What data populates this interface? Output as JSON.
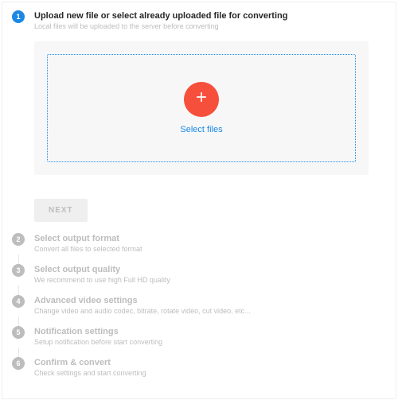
{
  "steps": [
    {
      "num": "1",
      "title": "Upload new file or select already uploaded file for converting",
      "sub": "Local files will be uploaded to the server before converting"
    },
    {
      "num": "2",
      "title": "Select output format",
      "sub": "Convert all files to selected format"
    },
    {
      "num": "3",
      "title": "Select output quality",
      "sub": "We recommend to use high Full HD quality"
    },
    {
      "num": "4",
      "title": "Advanced video settings",
      "sub": "Change video and audio codec, bitrate, rotate video, cut video, etc..."
    },
    {
      "num": "5",
      "title": "Notification settings",
      "sub": "Setup notification before start converting"
    },
    {
      "num": "6",
      "title": "Confirm & convert",
      "sub": "Check settings and start converting"
    }
  ],
  "select_files_label": "Select files",
  "next_label": "NEXT",
  "colors": {
    "accent": "#1b88e6",
    "plus": "#f6503c"
  }
}
